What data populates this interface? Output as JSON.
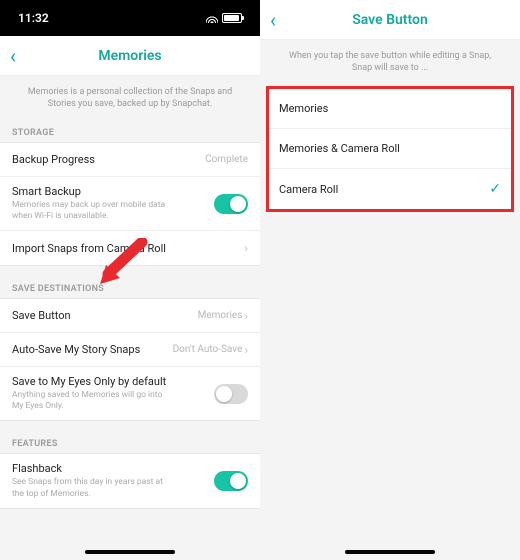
{
  "left": {
    "status": {
      "time": "11:32"
    },
    "header": {
      "title": "Memories"
    },
    "subtitle": "Memories is a personal collection of the Snaps and Stories you save, backed up by Snapchat.",
    "sections": {
      "storage": {
        "label": "STORAGE",
        "backup_progress": {
          "title": "Backup Progress",
          "value": "Complete"
        },
        "smart_backup": {
          "title": "Smart Backup",
          "sub": "Memories may back up over mobile data when Wi-Fi is unavailable."
        },
        "import": {
          "title": "Import Snaps from Camera Roll"
        }
      },
      "save_dest": {
        "label": "SAVE DESTINATIONS",
        "save_button": {
          "title": "Save Button",
          "value": "Memories"
        },
        "auto_save": {
          "title": "Auto-Save My Story Snaps",
          "value": "Don't Auto-Save"
        },
        "eyes_only": {
          "title": "Save to My Eyes Only by default",
          "sub": "Anything saved to Memories will go into My Eyes Only."
        }
      },
      "features": {
        "label": "FEATURES",
        "flashback": {
          "title": "Flashback",
          "sub": "See Snaps from this day in years past at the top of Memories."
        }
      }
    }
  },
  "right": {
    "header": {
      "title": "Save Button"
    },
    "subtitle": "When you tap the save button while editing a Snap, Snap will save to ...",
    "options": {
      "o1": "Memories",
      "o2": "Memories & Camera Roll",
      "o3": "Camera Roll"
    }
  }
}
